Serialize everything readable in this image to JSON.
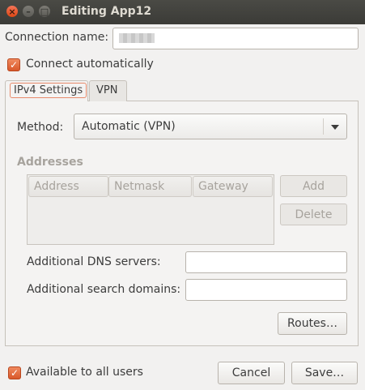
{
  "window": {
    "title": "Editing App12"
  },
  "connection": {
    "name_label": "Connection name:",
    "name_value": "",
    "connect_auto_label": "Connect automatically"
  },
  "tabs": [
    {
      "label": "IPv4 Settings",
      "active": true
    },
    {
      "label": "VPN",
      "active": false
    }
  ],
  "ipv4": {
    "method_label": "Method:",
    "method_value": "Automatic (VPN)",
    "addresses_label": "Addresses",
    "columns": [
      "Address",
      "Netmask",
      "Gateway"
    ],
    "add_button": "Add",
    "delete_button": "Delete",
    "dns_label": "Additional DNS servers:",
    "dns_value": "",
    "search_label": "Additional search domains:",
    "search_value": "",
    "routes_button": "Routes…"
  },
  "footer": {
    "all_users_label": "Available to all users",
    "cancel_button": "Cancel",
    "save_button": "Save…"
  },
  "colors": {
    "accent": "#dd5a2b",
    "titlebar": "#3c3b37"
  }
}
